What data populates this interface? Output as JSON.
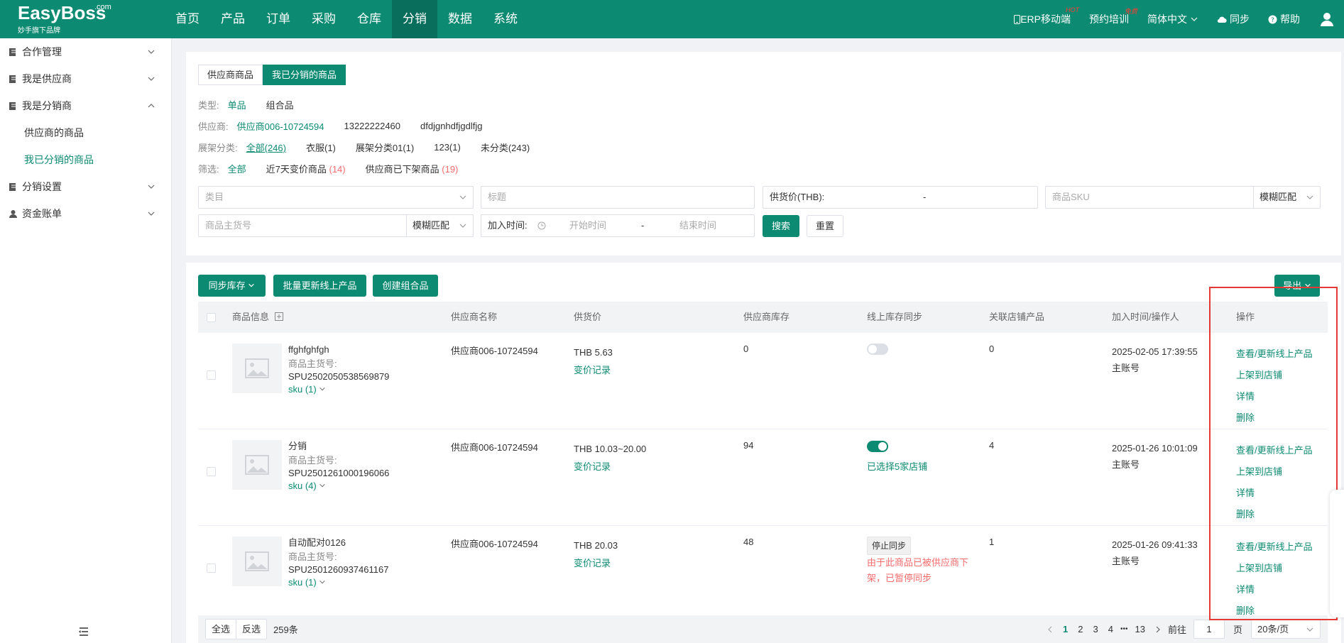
{
  "app": {
    "brand": "EasyBoss",
    "brand_suffix": ".com",
    "brand_sub": "妙手旗下品牌"
  },
  "nav": [
    "首页",
    "产品",
    "订单",
    "采购",
    "仓库",
    "分销",
    "数据",
    "系统"
  ],
  "nav_active": "分销",
  "top_right": {
    "mobile": "ERP移动端",
    "mobile_badge": "HOT",
    "training": "预约培训",
    "training_badge": "免费",
    "language": "简体中文",
    "sync": "同步",
    "help": "帮助"
  },
  "sidebar": {
    "items": [
      {
        "label": "合作管理"
      },
      {
        "label": "我是供应商"
      },
      {
        "label": "我是分销商",
        "children": [
          {
            "label": "供应商的商品"
          },
          {
            "label": "我已分销的商品"
          }
        ]
      },
      {
        "label": "分销设置"
      },
      {
        "label": "资金账单"
      }
    ]
  },
  "tabs": [
    "供应商商品",
    "我已分销的商品"
  ],
  "filters": {
    "type": {
      "label": "类型:",
      "options": [
        "单品",
        "组合品"
      ]
    },
    "supplier": {
      "label": "供应商:",
      "options": [
        "供应商006-10724594",
        "13222222460",
        "dfdjgnhdfjgdlfjg"
      ]
    },
    "shelf": {
      "label": "展架分类:",
      "options": [
        "全部(246)",
        "衣服(1)",
        "展架分类01(1)",
        "123(1)",
        "未分类(243)"
      ]
    },
    "screen": {
      "label": "筛选:",
      "all": "全部",
      "price_change": "近7天变价商品",
      "price_change_count": "(14)",
      "delisted": "供应商已下架商品",
      "delisted_count": "(19)"
    }
  },
  "search": {
    "category": "类目",
    "title": "标题",
    "price_label": "供货价(THB):",
    "price_sep": "-",
    "sku": "商品SKU",
    "sku_match": "模糊匹配",
    "spu": "商品主货号",
    "spu_match": "模糊匹配",
    "time_label": "加入时间:",
    "start": "开始时间",
    "time_sep": "-",
    "end": "结束时间",
    "search_btn": "搜索",
    "reset_btn": "重置"
  },
  "toolbar": {
    "sync_stock": "同步库存",
    "batch_update": "批量更新线上产品",
    "create_combo": "创建组合品",
    "export": "导出"
  },
  "columns": [
    "商品信息",
    "供应商名称",
    "供货价",
    "供应商库存",
    "线上库存同步",
    "关联店铺产品",
    "加入时间/操作人",
    "操作"
  ],
  "rows": [
    {
      "name": "ffghfghfgh",
      "spu_label": "商品主货号:",
      "spu": "SPU2502050538569879",
      "sku": "sku (1)",
      "supplier": "供应商006-10724594",
      "price": "THB 5.63",
      "price_log": "变价记录",
      "stock": "0",
      "sync_on": false,
      "sync_text": "",
      "linked": "0",
      "time": "2025-02-05 17:39:55",
      "operator": "主账号"
    },
    {
      "name": "分销",
      "spu_label": "商品主货号:",
      "spu": "SPU2501261000196066",
      "sku": "sku (4)",
      "supplier": "供应商006-10724594",
      "price": "THB 10.03~20.00",
      "price_log": "变价记录",
      "stock": "94",
      "sync_on": true,
      "sync_text": "已选择5家店铺",
      "linked": "4",
      "time": "2025-01-26 10:01:09",
      "operator": "主账号"
    },
    {
      "name": "自动配对0126",
      "spu_label": "商品主货号:",
      "spu": "SPU2501260937461167",
      "sku": "sku (1)",
      "supplier": "供应商006-10724594",
      "price": "THB 20.03",
      "price_log": "变价记录",
      "stock": "48",
      "sync_tag": "停止同步",
      "sync_warn_1": "由于此商品已被供应商下",
      "sync_warn_2": "架，已暂停同步",
      "linked": "1",
      "time": "2025-01-26 09:41:33",
      "operator": "主账号"
    }
  ],
  "actions": [
    "查看/更新线上产品",
    "上架到店铺",
    "详情",
    "删除"
  ],
  "footer": {
    "select_all": "全选",
    "invert": "反选",
    "total": "259条",
    "pages": [
      "1",
      "2",
      "3",
      "4",
      "•••",
      "13"
    ],
    "goto": "前往",
    "page_input": "1",
    "page_unit": "页",
    "page_size": "20条/页"
  },
  "colors": {
    "primary": "#0c8a72",
    "danger": "#f56c6c",
    "highlight_box": "#e53935"
  }
}
